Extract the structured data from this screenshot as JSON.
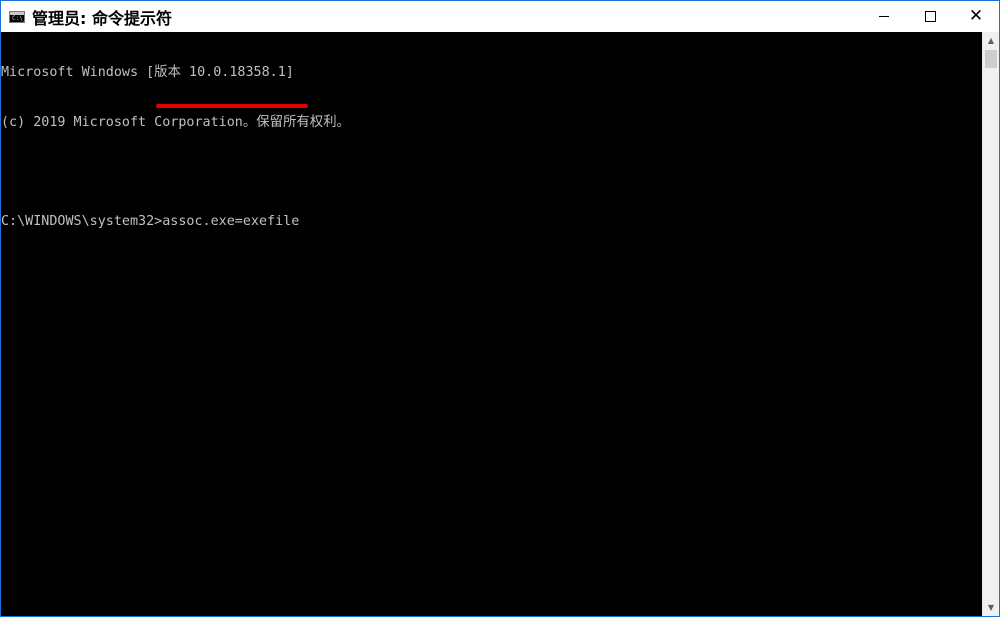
{
  "window": {
    "title": "管理员: 命令提示符",
    "icon_label": "C:\\_"
  },
  "controls": {
    "minimize": "minimize-icon",
    "maximize": "maximize-icon",
    "close": "✕"
  },
  "console": {
    "lines": [
      "Microsoft Windows [版本 10.0.18358.1]",
      "(c) 2019 Microsoft Corporation。保留所有权利。",
      "",
      "C:\\WINDOWS\\system32>assoc.exe=exefile"
    ],
    "highlight_color": "#e00000",
    "text_color": "#c0c0c0",
    "background_color": "#000000"
  },
  "scrollbar": {
    "up_arrow": "▲",
    "down_arrow": "▼"
  }
}
